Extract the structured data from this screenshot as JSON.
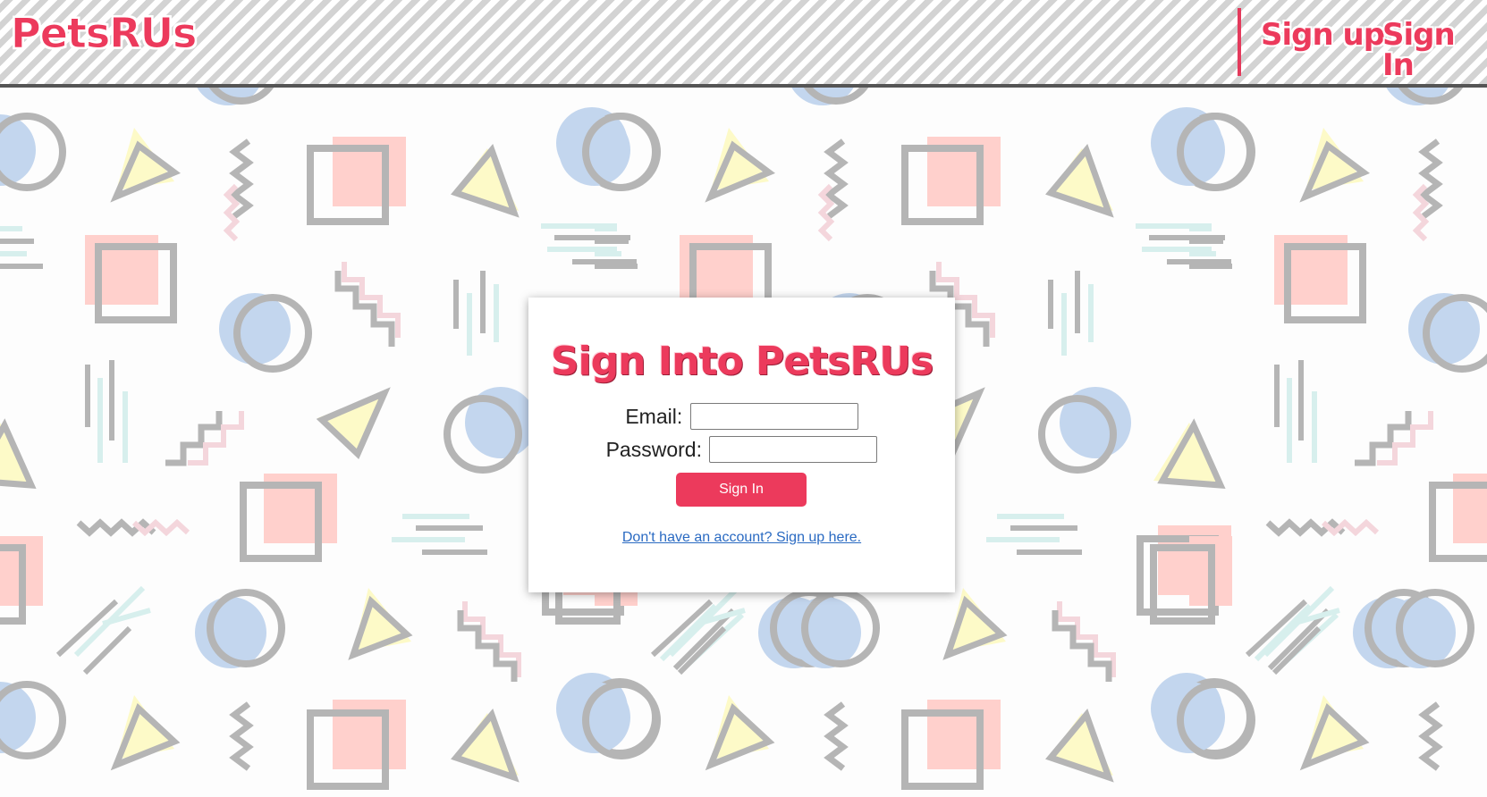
{
  "header": {
    "brand": "PetsRUs",
    "nav": {
      "signup": "Sign up",
      "signin": "Sign In"
    }
  },
  "card": {
    "title": "Sign Into PetsRUs",
    "email_label": "Email:",
    "email_value": "",
    "password_label": "Password:",
    "password_value": "",
    "submit_label": "Sign In",
    "signup_link": "Don't have an account? Sign up here."
  },
  "colors": {
    "accent": "#ec3a5c",
    "link": "#2a6ac2",
    "header_stripe": "#d3d3d3",
    "header_border": "#555555",
    "pattern_gray": "#b5b5b5",
    "pattern_blue": "#c3d6ee",
    "pattern_pink": "#ffd0cc",
    "pattern_yellow": "#fdfac8",
    "pattern_mint": "#d7efed"
  }
}
